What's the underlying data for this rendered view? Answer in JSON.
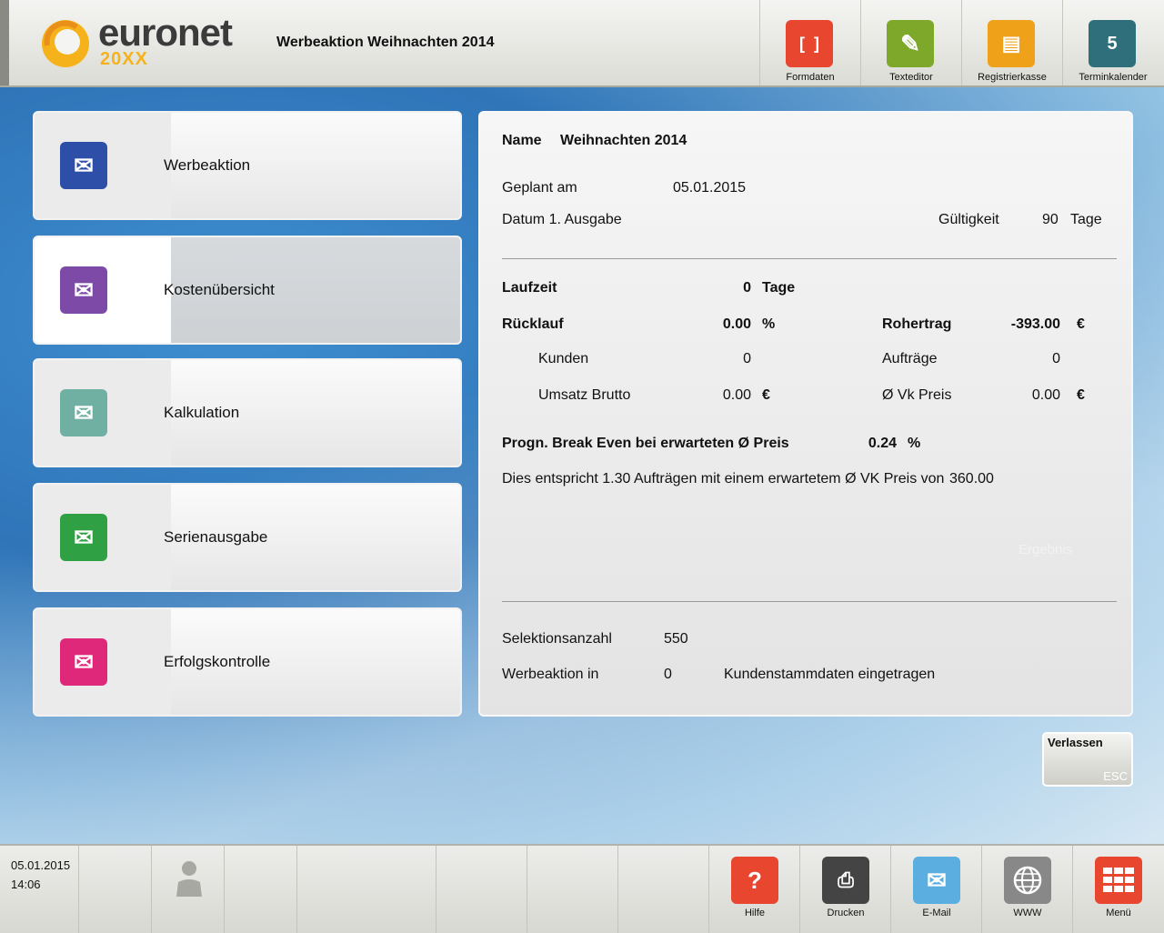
{
  "header": {
    "brand": "euronet",
    "brand_sub": "20XX",
    "title": "Werbeaktion Weihnachten 2014",
    "toolbar": [
      {
        "label": "Formdaten",
        "icon": "form-data-icon",
        "color": "#e8462e"
      },
      {
        "label": "Texteditor",
        "icon": "pencil-icon",
        "color": "#7ea82a"
      },
      {
        "label": "Registrierkasse",
        "icon": "cash-register-icon",
        "color": "#f0a11a"
      },
      {
        "label": "Terminkalender",
        "icon": "calendar-icon",
        "color": "#2f6f7b",
        "day": "5"
      }
    ]
  },
  "menu": [
    {
      "label": "Werbeaktion",
      "icon": "mail-group-icon",
      "color": "#2e4fa8"
    },
    {
      "label": "Kostenübersicht",
      "icon": "mail-euro-icon",
      "color": "#7d4aa8",
      "active": true
    },
    {
      "label": "Kalkulation",
      "icon": "mail-calculator-icon",
      "color": "#6fb0a2"
    },
    {
      "label": "Serienausgabe",
      "icon": "mail-stack-icon",
      "color": "#2fa043"
    },
    {
      "label": "Erfolgskontrolle",
      "icon": "mail-chart-icon",
      "color": "#e0287a"
    }
  ],
  "panel": {
    "name_label": "Name",
    "name_value": "Weihnachten 2014",
    "geplant_label": "Geplant am",
    "geplant_value": "05.01.2015",
    "datum_label": "Datum 1. Ausgabe",
    "gueltigkeit_label": "Gültigkeit",
    "gueltigkeit_value": "90",
    "gueltigkeit_unit": "Tage",
    "laufzeit_label": "Laufzeit",
    "laufzeit_value": "0",
    "laufzeit_unit": "Tage",
    "ruecklauf_label": "Rücklauf",
    "ruecklauf_value": "0.00",
    "ruecklauf_unit": "%",
    "rohertrag_label": "Rohertrag",
    "rohertrag_value": "-393.00",
    "rohertrag_unit": "€",
    "kunden_label": "Kunden",
    "kunden_value": "0",
    "auftraege_label": "Aufträge",
    "auftraege_value": "0",
    "umsatz_label": "Umsatz Brutto",
    "umsatz_value": "0.00",
    "umsatz_unit": "€",
    "vkpreis_label": "Ø Vk Preis",
    "vkpreis_value": "0.00",
    "vkpreis_unit": "€",
    "breakeven_label": "Progn. Break Even bei erwarteten Ø Preis",
    "breakeven_value": "0.24",
    "breakeven_unit": "%",
    "info_text": "Dies entspricht 1.30 Aufträgen mit einem erwartetem Ø VK Preis von",
    "info_value": "360.00",
    "ergebnis_label": "Ergebnis",
    "selektion_label": "Selektionsanzahl",
    "selektion_value": "550",
    "werbeaktion_label": "Werbeaktion in",
    "werbeaktion_value": "0",
    "werbeaktion_text": "Kundenstammdaten eingetragen"
  },
  "exit": {
    "label": "Verlassen",
    "shortcut": "ESC"
  },
  "footer": {
    "date": "05.01.2015",
    "time": "14:06",
    "buttons": [
      {
        "label": "Hilfe",
        "icon": "help-icon",
        "color": "#e8462e"
      },
      {
        "label": "Drucken",
        "icon": "printer-icon",
        "color": "#444444"
      },
      {
        "label": "E-Mail",
        "icon": "mail-icon",
        "color": "#5aaee0"
      },
      {
        "label": "WWW",
        "icon": "globe-icon",
        "color": "#888888"
      },
      {
        "label": "Menü",
        "icon": "menu-grid-icon",
        "color": "#e8462e"
      }
    ]
  }
}
